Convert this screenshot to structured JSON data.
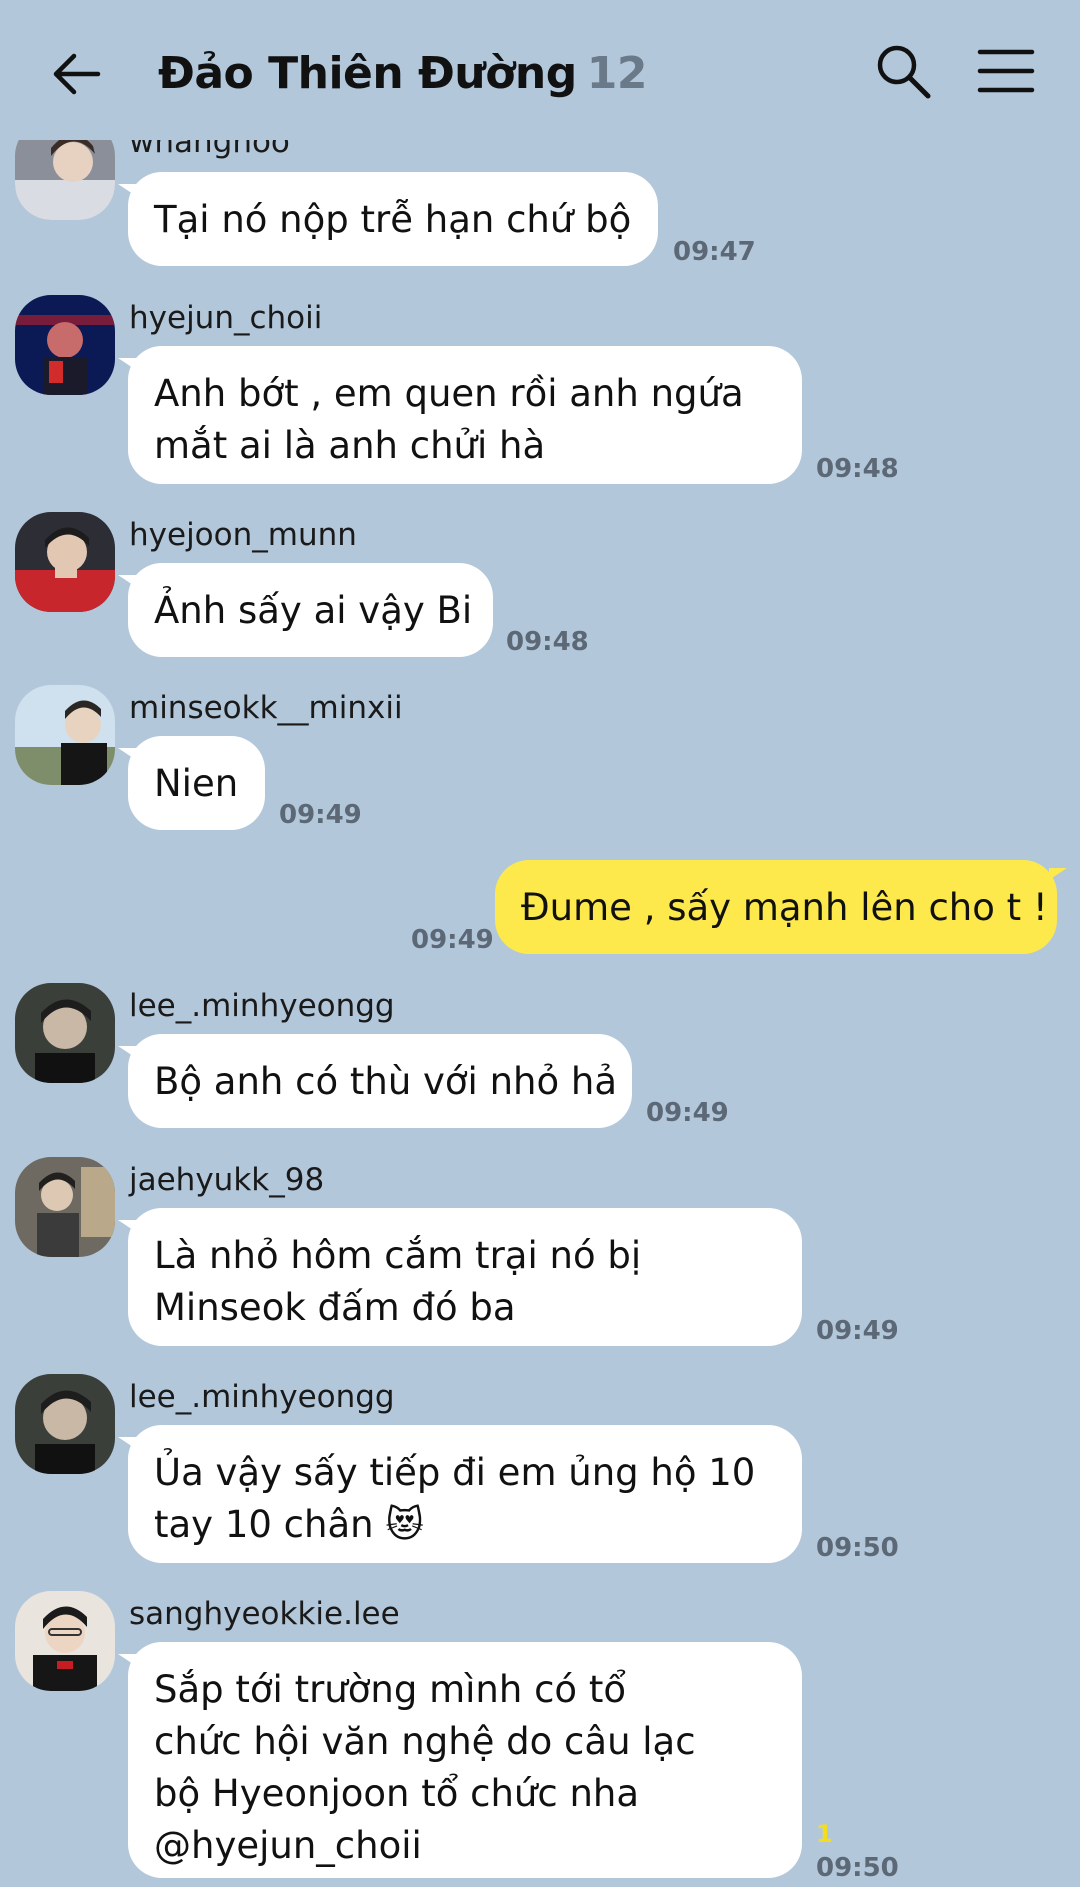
{
  "header": {
    "title": "Đảo Thiên Đường",
    "member_count": "12",
    "back_icon": "arrow-left-icon",
    "search_icon": "search-icon",
    "menu_icon": "hamburger-menu-icon"
  },
  "messages": [
    {
      "sender": "whanghoo",
      "text": "Tại nó nộp trễ hạn chứ bộ",
      "time": "09:47"
    },
    {
      "sender": "hyejun_choii",
      "text": "Anh bớt , em quen rồi anh ngứa\nmắt ai là anh chửi hà",
      "time": "09:48"
    },
    {
      "sender": "hyejoon_munn",
      "text": "Ảnh sấy ai vậy Bi",
      "time": "09:48"
    },
    {
      "sender": "minseokk__minxii",
      "text": "Nien",
      "time": "09:49"
    },
    {
      "sender": "",
      "text": "Đume , sấy mạnh lên cho t !",
      "time": "09:49",
      "outgoing": true
    },
    {
      "sender": "lee_.minhyeongg",
      "text": "Bộ anh có thù với nhỏ hả",
      "time": "09:49"
    },
    {
      "sender": "jaehyukk_98",
      "text": "Là nhỏ hôm cắm trại nó bị\nMinseok đấm đó ba",
      "time": "09:49"
    },
    {
      "sender": "lee_.minhyeongg",
      "text": "Ủa vậy sấy tiếp đi em ủng hộ 10\ntay 10 chân 😻",
      "time": "09:50"
    },
    {
      "sender": "sanghyeokkie.lee",
      "text": "Sắp tới trường mình có tổ\nchức hội văn nghệ do câu lạc\nbộ Hyeonjoon tổ chức nha\n@hyejun_choii",
      "time": "09:50",
      "unread": "1"
    }
  ],
  "colors": {
    "background": "#b3c7db",
    "incoming_bubble": "#ffffff",
    "outgoing_bubble": "#fde94b",
    "timestamp": "#5c6875",
    "unread": "#f4dd1a"
  }
}
